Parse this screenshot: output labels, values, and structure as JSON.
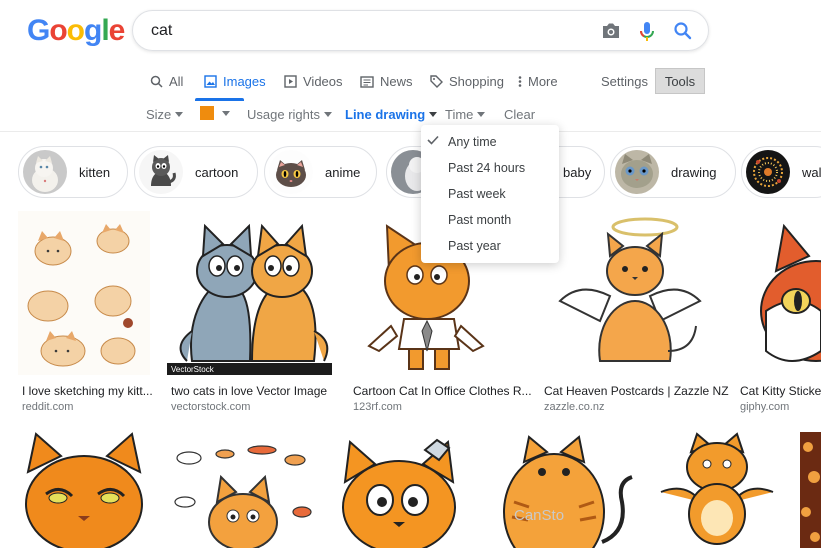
{
  "logo": {
    "letters": [
      "G",
      "o",
      "o",
      "g",
      "l",
      "e"
    ],
    "colors": [
      "#4285f4",
      "#ea4335",
      "#fbbc05",
      "#4285f4",
      "#34a853",
      "#ea4335"
    ]
  },
  "search": {
    "query": "cat"
  },
  "tabs": [
    {
      "label": "All",
      "icon": "search-icon"
    },
    {
      "label": "Images",
      "icon": "image-icon",
      "active": true
    },
    {
      "label": "Videos",
      "icon": "play-icon"
    },
    {
      "label": "News",
      "icon": "news-icon"
    },
    {
      "label": "Shopping",
      "icon": "tag-icon"
    },
    {
      "label": "More",
      "icon": "more-vert-icon"
    }
  ],
  "settings_label": "Settings",
  "tools_label": "Tools",
  "filters": {
    "size": "Size",
    "color_swatch": "#ef8c0e",
    "usage_rights": "Usage rights",
    "type": "Line drawing",
    "time": "Time",
    "clear": "Clear"
  },
  "chips": [
    {
      "label": "kitten"
    },
    {
      "label": "cartoon"
    },
    {
      "label": "anime"
    },
    {
      "label": ""
    },
    {
      "label": "baby"
    },
    {
      "label": "drawing"
    },
    {
      "label": "wal"
    }
  ],
  "time_menu": {
    "items": [
      "Any time",
      "Past 24 hours",
      "Past week",
      "Past month",
      "Past year"
    ],
    "selected": "Any time"
  },
  "results_row1": [
    {
      "title": "I love sketching my kitt...",
      "source": "reddit.com"
    },
    {
      "title": "two cats in love Vector Image",
      "source": "vectorstock.com",
      "watermark": "VectorStock"
    },
    {
      "title": "Cartoon Cat In Office Clothes R...",
      "source": "123rf.com"
    },
    {
      "title": "Cat Heaven Postcards | Zazzle NZ",
      "source": "zazzle.co.nz"
    },
    {
      "title": "Cat Kitty Sticker",
      "source": "giphy.com"
    }
  ],
  "results_row2_watermark": "CanSto"
}
